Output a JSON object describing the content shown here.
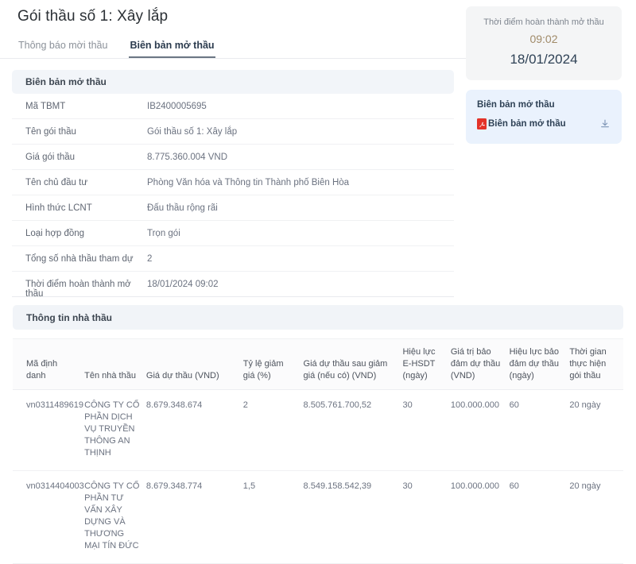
{
  "header": {
    "title": "Gói thầu số 1: Xây lắp"
  },
  "tabs": [
    {
      "label": "Thông báo mời thầu",
      "active": false
    },
    {
      "label": "Biên bản mở thầu",
      "active": true
    }
  ],
  "minutes_panel": {
    "heading": "Biên bản mở thầu",
    "rows": [
      {
        "label": "Mã TBMT",
        "value": "IB2400005695"
      },
      {
        "label": "Tên gói thầu",
        "value": "Gói thầu số 1: Xây lắp"
      },
      {
        "label": "Giá gói thầu",
        "value": "8.775.360.004 VND"
      },
      {
        "label": "Tên chủ đầu tư",
        "value": "Phòng Văn hóa và Thông tin Thành phố Biên Hòa"
      },
      {
        "label": "Hình thức LCNT",
        "value": "Đấu thầu rộng rãi"
      },
      {
        "label": "Loại hợp đồng",
        "value": "Trọn gói"
      },
      {
        "label": "Tổng số nhà thầu tham dự",
        "value": "2"
      },
      {
        "label": "Thời điểm hoàn thành mở thầu",
        "value": "18/01/2024 09:02"
      }
    ]
  },
  "sidebar": {
    "time_card": {
      "label": "Thời điểm hoàn thành mở thầu",
      "time": "09:02",
      "date": "18/01/2024",
      "time_color": "#a08a68",
      "date_color": "#2f4256"
    },
    "file_card": {
      "title": "Biên bản mở thầu",
      "file_name": "Biên bản mở thầu",
      "file_type_icon": "pdf-file-icon",
      "download_icon": "download-icon",
      "pdf_color": "#e33229",
      "accent_bg": "#eaf2fd"
    }
  },
  "bidders_section": {
    "heading": "Thông tin nhà thầu",
    "columns": [
      "Mã định danh",
      "Tên nhà thầu",
      "Giá dự thầu (VND)",
      "Tỷ lệ giảm giá (%)",
      "Giá dự thầu sau giảm giá (nếu có) (VND)",
      "Hiệu lực E-HSDT (ngày)",
      "Giá trị bảo đảm dự thầu (VND)",
      "Hiệu lực bảo đảm dự thầu (ngày)",
      "Thời gian thực hiện gói thầu"
    ],
    "rows": [
      {
        "id": "vn0311489619",
        "name": "CÔNG TY CỔ PHẦN DỊCH VỤ TRUYỀN THÔNG AN THỊNH",
        "bid_price": "8.679.348.674",
        "discount_pct": "2",
        "bid_price_after_discount": "8.505.761.700,52",
        "ehsdt_validity_days": "30",
        "bid_security_value": "100.000.000",
        "bid_security_validity_days": "60",
        "implementation_time": "20 ngày"
      },
      {
        "id": "vn0314404003",
        "name": "CÔNG TY CỔ PHẦN TƯ VẤN XÂY DỰNG VÀ THƯƠNG MẠI TÍN ĐỨC",
        "bid_price": "8.679.348.774",
        "discount_pct": "1,5",
        "bid_price_after_discount": "8.549.158.542,39",
        "ehsdt_validity_days": "30",
        "bid_security_value": "100.000.000",
        "bid_security_validity_days": "60",
        "implementation_time": "20 ngày"
      }
    ]
  }
}
